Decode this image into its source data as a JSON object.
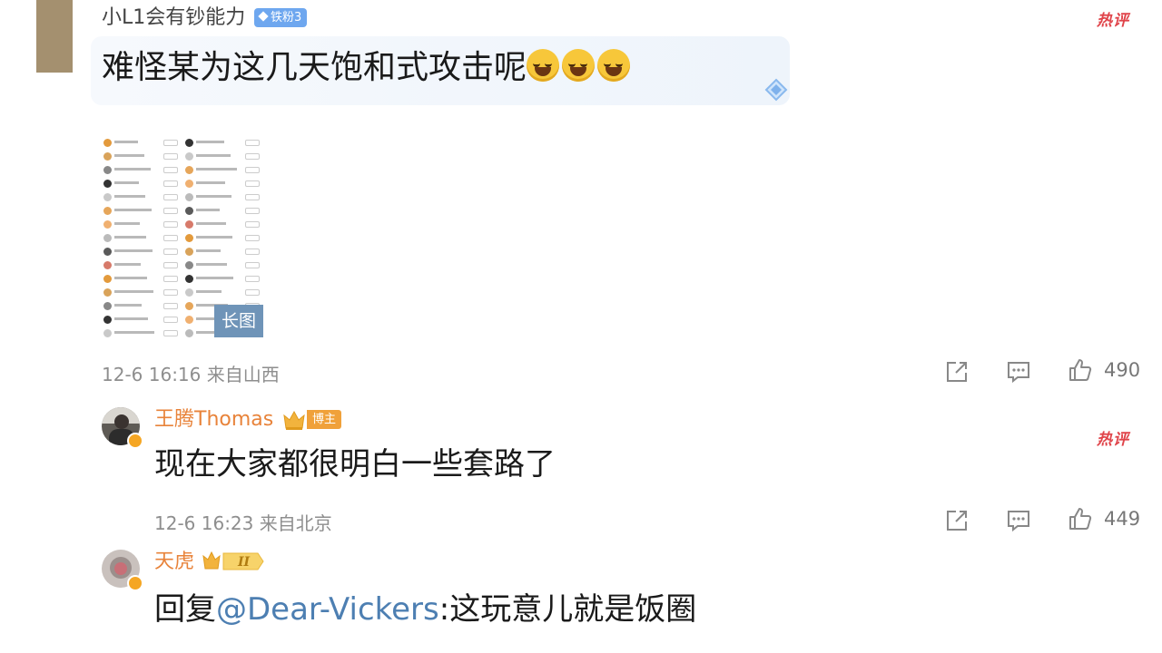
{
  "comments": [
    {
      "username": "小L1会有钞能力",
      "fan_badge": "铁粉3",
      "hot_label": "热评",
      "text": "难怪某为这几天饱和式攻击呢",
      "emoji_icons": [
        "laughing-crying-emoji",
        "laughing-crying-emoji",
        "laughing-crying-emoji"
      ],
      "image_tag": "长图",
      "time": "12-6 16:16",
      "location": "来自山西",
      "likes": "490"
    },
    {
      "username": "王腾Thomas",
      "author_badge": "博主",
      "hot_label": "热评",
      "text": "现在大家都很明白一些套路了",
      "time": "12-6 16:23",
      "location": "来自北京",
      "likes": "449"
    },
    {
      "username": "天虎",
      "level_badge": "II",
      "reply_prefix": "回复",
      "mention": "@Dear-Vickers",
      "text": ":这玩意儿就是饭圈"
    }
  ],
  "colors": {
    "hot": "#e0444a",
    "username": "#e8833a",
    "mention": "#4d7fb2",
    "fan_badge": "#6ea7ef",
    "author_badge": "#f0a13a"
  }
}
